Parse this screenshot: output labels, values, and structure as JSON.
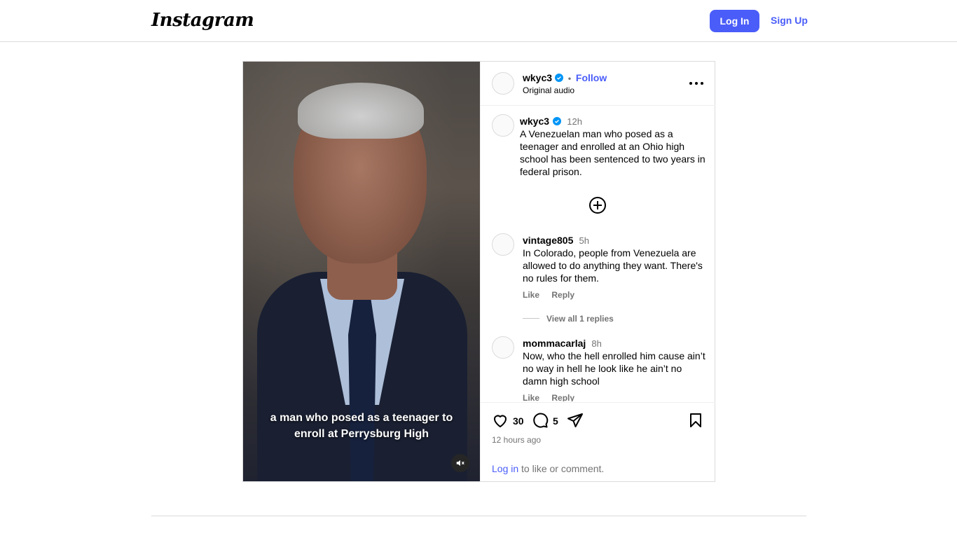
{
  "topbar": {
    "logo": "Instagram",
    "login_label": "Log In",
    "signup_label": "Sign Up"
  },
  "media": {
    "caption_line1": "a man who posed as a teenager to",
    "caption_line2": "enroll at Perrysburg High"
  },
  "post_header": {
    "username": "wkyc3",
    "separator": "•",
    "follow_label": "Follow",
    "audio": "Original audio"
  },
  "caption_comment": {
    "username": "wkyc3",
    "time": "12h",
    "text": "A Venezuelan man who posed as a teenager and enrolled at an Ohio high school has been sentenced to two years in federal prison."
  },
  "comments": [
    {
      "username": "vintage805",
      "time": "5h",
      "text": "In Colorado, people from Venezuela are allowed to do anything they want. There's no rules for them.",
      "like_label": "Like",
      "reply_label": "Reply",
      "view_replies": "View all 1 replies"
    },
    {
      "username": "mommacarlaj",
      "time": "8h",
      "text": "Now, who the hell enrolled him cause ain’t no way in hell he look like he ain’t no damn high school",
      "like_label": "Like",
      "reply_label": "Reply"
    }
  ],
  "actions": {
    "likes": "30",
    "comments": "5",
    "posted_ago": "12 hours ago",
    "login_link": "Log in",
    "login_suffix": " to like or comment."
  },
  "colors": {
    "accent": "#4a5df9",
    "verified": "#0095f6",
    "muted_text": "#737373",
    "border": "#dbdbdb"
  },
  "icons": [
    "verified-badge-icon",
    "more-options-icon",
    "add-comment-icon",
    "heart-icon",
    "comment-icon",
    "share-icon",
    "bookmark-icon",
    "muted-speaker-icon"
  ]
}
